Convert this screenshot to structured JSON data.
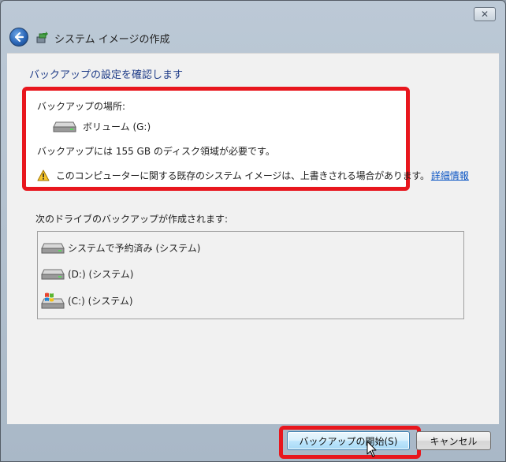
{
  "window": {
    "close_glyph": "✕",
    "title": "システム イメージの作成"
  },
  "page": {
    "subtitle": "バックアップの設定を確認します"
  },
  "confirm": {
    "location_label": "バックアップの場所:",
    "target_drive": "ボリューム (G:)",
    "space_required": "バックアップには 155 GB のディスク領域が必要です。",
    "warning_text": "このコンピューターに関する既存のシステム イメージは、上書きされる場合があります。",
    "details_link": "詳細情報"
  },
  "drives": {
    "label": "次のドライブのバックアップが作成されます:",
    "items": [
      {
        "label": "システムで予約済み (システム)",
        "icon": "hard-drive-icon"
      },
      {
        "label": "(D:) (システム)",
        "icon": "hard-drive-icon"
      },
      {
        "label": "(C:) (システム)",
        "icon": "windows-drive-icon"
      }
    ]
  },
  "buttons": {
    "start_backup": "バックアップの開始(S)",
    "cancel": "キャンセル"
  },
  "colors": {
    "highlight": "#e8161d",
    "link": "#0b55c4",
    "subtitle": "#1f3c88"
  }
}
